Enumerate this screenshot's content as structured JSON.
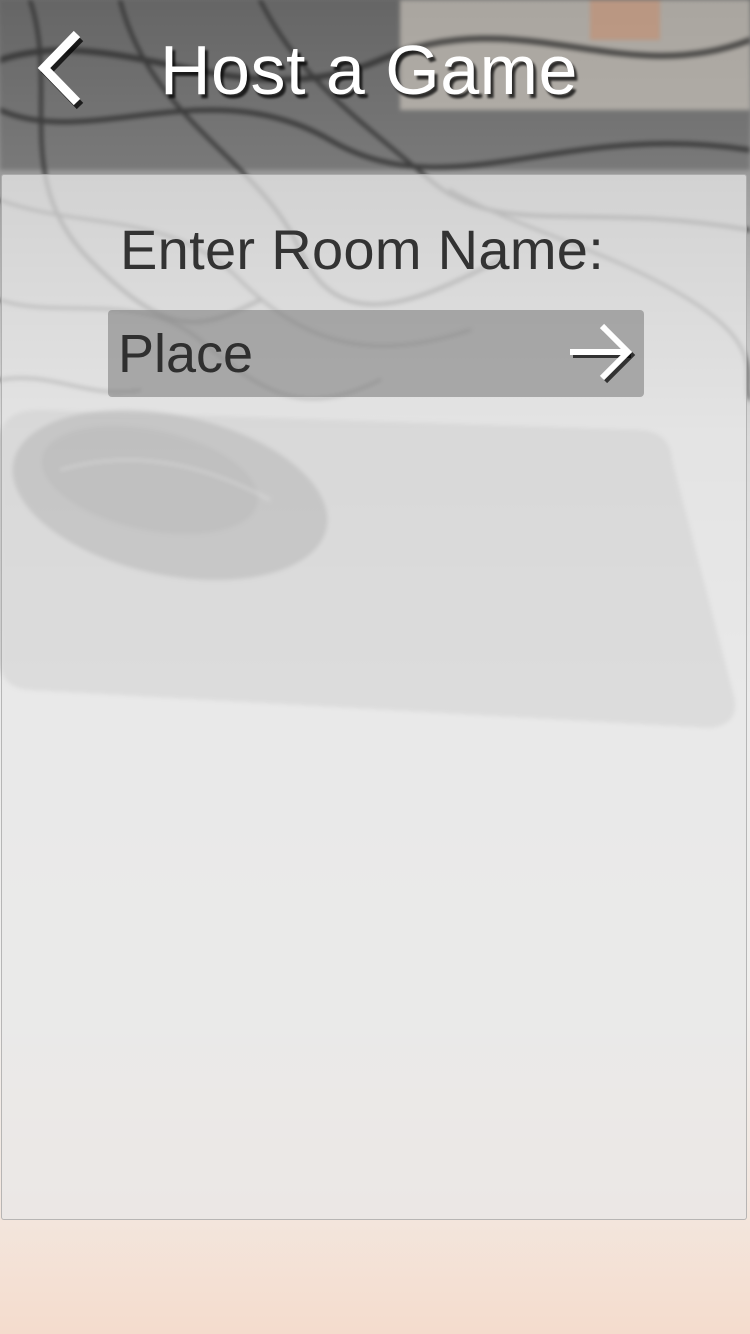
{
  "header": {
    "title": "Host a Game",
    "back_icon": "chevron-left-icon"
  },
  "form": {
    "label": "Enter Room Name:",
    "room_name_value": "Place",
    "submit_icon": "arrow-right-icon"
  },
  "colors": {
    "title_text": "#ffffff",
    "label_text": "#333333",
    "input_bg": "#8a8a8a",
    "panel_bg": "#e8e8e8"
  }
}
